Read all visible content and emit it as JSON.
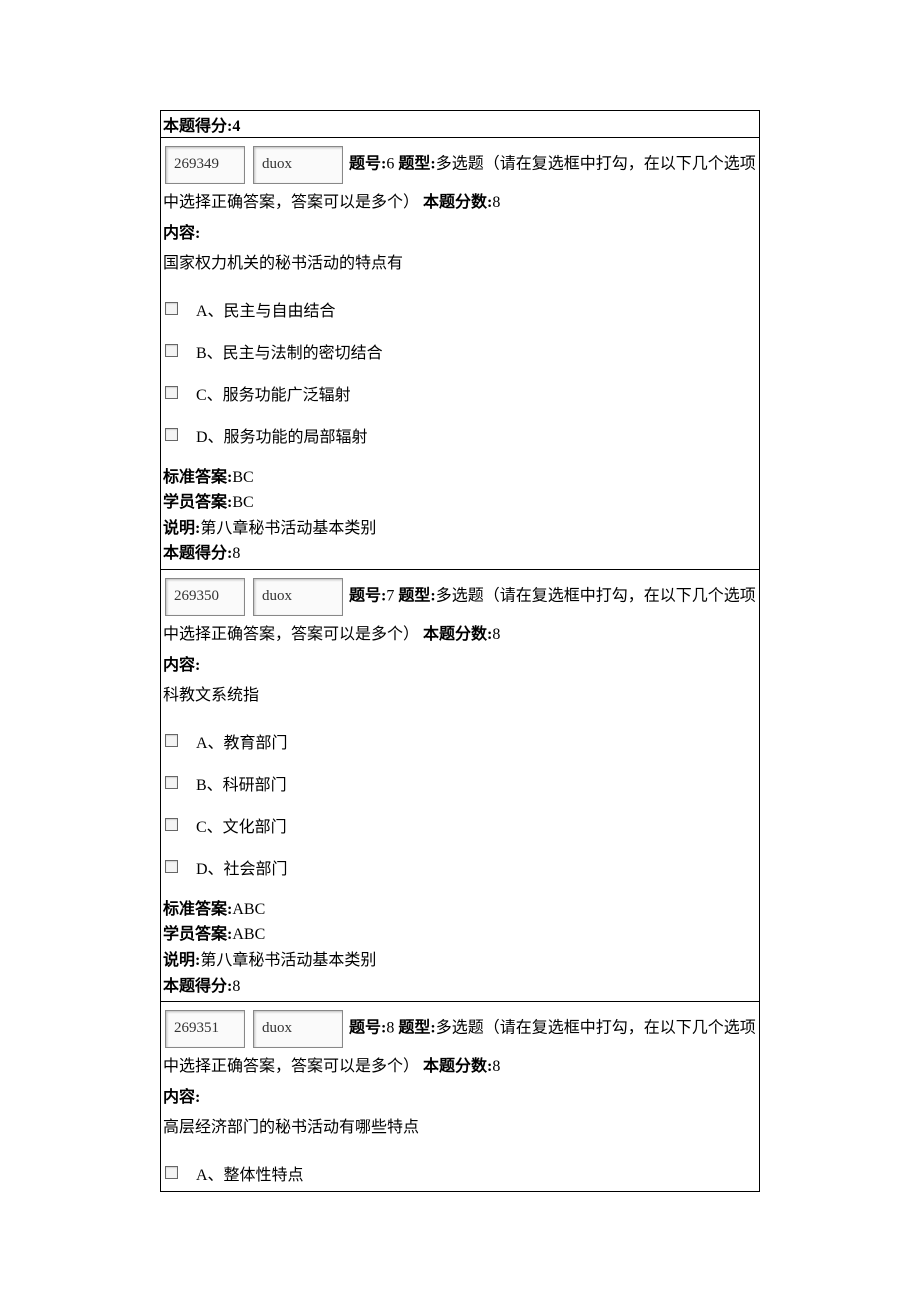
{
  "labels": {
    "questionNumber": "题号:",
    "questionType": "题型:",
    "fullScore": "本题分数:",
    "content": "内容:",
    "standardAnswer": "标准答案:",
    "studentAnswer": "学员答案:",
    "desc": "说明:",
    "scoreObtained": "本题得分:",
    "typeDesc": "多选题（请在复选框中打勾，在以下几个选项中选择正确答案，答案可以是多个）"
  },
  "prevScore": {
    "score": "4"
  },
  "questions": [
    {
      "id": "269349",
      "code": "duox",
      "number": "6",
      "fullScore": "8",
      "prompt": "国家权力机关的秘书活动的特点有",
      "choices": [
        "A、民主与自由结合",
        "B、民主与法制的密切结合",
        "C、服务功能广泛辐射",
        "D、服务功能的局部辐射"
      ],
      "standardAnswer": "BC",
      "studentAnswer": "BC",
      "desc": "第八章秘书活动基本类别",
      "score": "8"
    },
    {
      "id": "269350",
      "code": "duox",
      "number": "7",
      "fullScore": "8",
      "prompt": "科教文系统指",
      "choices": [
        "A、教育部门",
        "B、科研部门",
        "C、文化部门",
        "D、社会部门"
      ],
      "standardAnswer": "ABC",
      "studentAnswer": "ABC",
      "desc": "第八章秘书活动基本类别",
      "score": "8"
    },
    {
      "id": "269351",
      "code": "duox",
      "number": "8",
      "fullScore": "8",
      "prompt": "高层经济部门的秘书活动有哪些特点",
      "choices": [
        "A、整体性特点"
      ],
      "standardAnswer": null,
      "studentAnswer": null,
      "desc": null,
      "score": null
    }
  ]
}
